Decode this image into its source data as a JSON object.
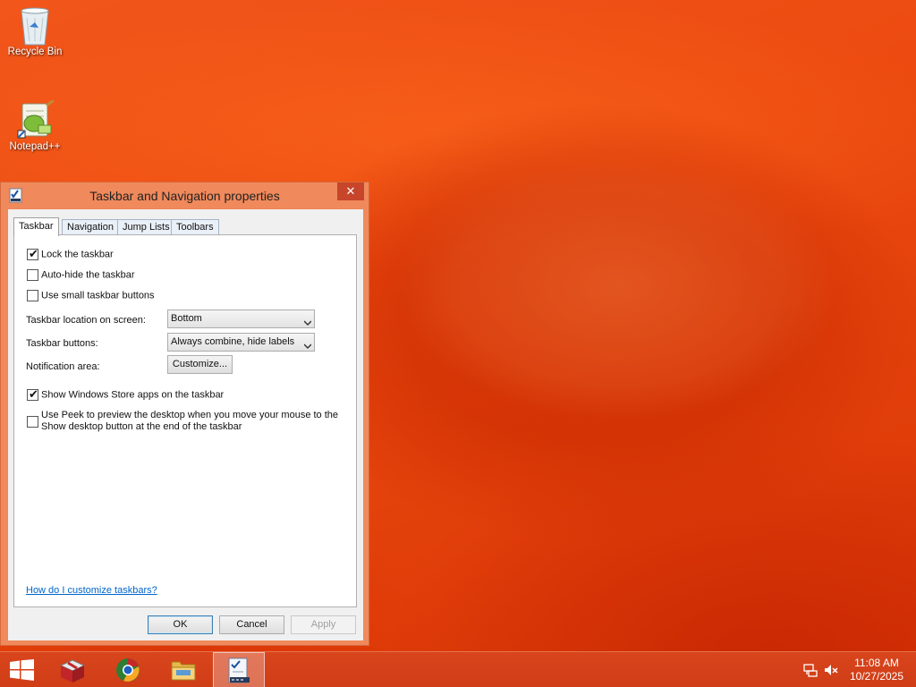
{
  "desktop": {
    "icons": [
      {
        "label": "Recycle Bin",
        "icon": "recycle-bin-icon"
      },
      {
        "label": "Notepad++",
        "icon": "notepad-plus-plus-icon"
      }
    ]
  },
  "dialog": {
    "title": "Taskbar and Navigation properties",
    "close_label": "✕",
    "tabs": [
      {
        "label": "Taskbar",
        "active": true
      },
      {
        "label": "Navigation",
        "active": false
      },
      {
        "label": "Jump Lists",
        "active": false
      },
      {
        "label": "Toolbars",
        "active": false
      }
    ],
    "options": {
      "lock_taskbar": {
        "label": "Lock the taskbar",
        "checked": true
      },
      "auto_hide": {
        "label": "Auto-hide the taskbar",
        "checked": false
      },
      "small_buttons": {
        "label": "Use small taskbar buttons",
        "checked": false
      },
      "store_apps": {
        "label": "Show Windows Store apps on the taskbar",
        "checked": true
      },
      "peek": {
        "label_line1": "Use Peek to preview the desktop when you move your mouse to the",
        "label_line2": "Show desktop button at the end of the taskbar",
        "checked": false
      }
    },
    "location": {
      "label": "Taskbar location on screen:",
      "value": "Bottom"
    },
    "buttons_setting": {
      "label": "Taskbar buttons:",
      "value": "Always combine, hide labels"
    },
    "notification": {
      "label": "Notification area:",
      "button": "Customize..."
    },
    "help_link": "How do I customize taskbars?",
    "footer": {
      "ok": "OK",
      "cancel": "Cancel",
      "apply": "Apply"
    },
    "check_glyph": "✔"
  },
  "taskbar": {
    "items": [
      {
        "name": "start",
        "icon": "windows-logo-icon"
      },
      {
        "name": "app-red-box",
        "icon": "red-box-app-icon"
      },
      {
        "name": "chrome",
        "icon": "browser-icon"
      },
      {
        "name": "file-explorer",
        "icon": "folder-icon"
      },
      {
        "name": "taskbar-properties",
        "icon": "taskbar-properties-icon",
        "active": true
      }
    ],
    "tray": {
      "network": "network-icon",
      "volume": "volume-muted-icon"
    },
    "clock": {
      "time": "11:08 AM",
      "date": "10/27/2025"
    }
  },
  "colors": {
    "accent": "#e8400c",
    "title_close": "#c7452b",
    "link": "#0066cc"
  }
}
